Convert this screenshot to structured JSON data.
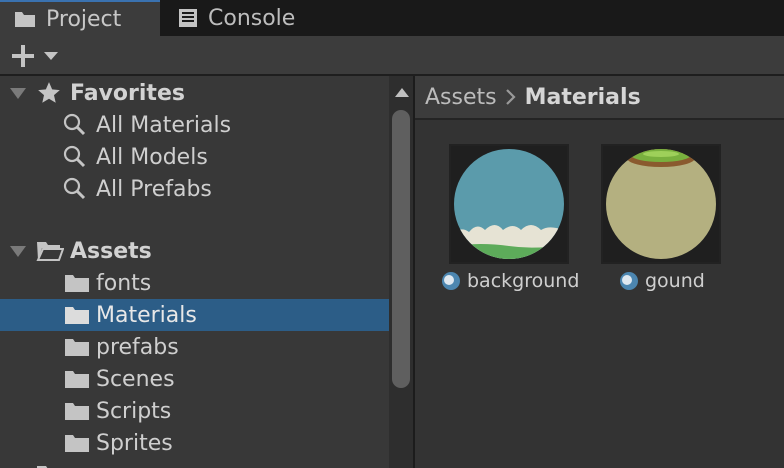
{
  "tabs": [
    {
      "label": "Project",
      "icon": "folder-icon",
      "active": true
    },
    {
      "label": "Console",
      "icon": "console-icon",
      "active": false
    }
  ],
  "toolbar": {
    "add_icon": "plus-icon",
    "dropdown_icon": "dropdown-arrow-icon"
  },
  "tree": {
    "favorites": {
      "label": "Favorites",
      "icon": "star-icon",
      "items": [
        {
          "label": "All Materials",
          "icon": "search-icon"
        },
        {
          "label": "All Models",
          "icon": "search-icon"
        },
        {
          "label": "All Prefabs",
          "icon": "search-icon"
        }
      ]
    },
    "assets": {
      "label": "Assets",
      "icon": "open-folder-icon",
      "items": [
        {
          "label": "fonts",
          "icon": "folder-icon",
          "selected": false
        },
        {
          "label": "Materials",
          "icon": "folder-icon",
          "selected": true
        },
        {
          "label": "prefabs",
          "icon": "folder-icon",
          "selected": false
        },
        {
          "label": "Scenes",
          "icon": "folder-icon",
          "selected": false
        },
        {
          "label": "Scripts",
          "icon": "folder-icon",
          "selected": false
        },
        {
          "label": "Sprites",
          "icon": "folder-icon",
          "selected": false
        }
      ]
    }
  },
  "breadcrumb": {
    "root": "Assets",
    "current": "Materials"
  },
  "assets": [
    {
      "label": "background",
      "icon": "material-icon",
      "sphere_color": "#5b9bab"
    },
    {
      "label": "gound",
      "icon": "material-icon",
      "sphere_color": "#b4b080"
    }
  ],
  "colors": {
    "selection": "#2c5d87",
    "tab_accent": "#3a72b0"
  }
}
